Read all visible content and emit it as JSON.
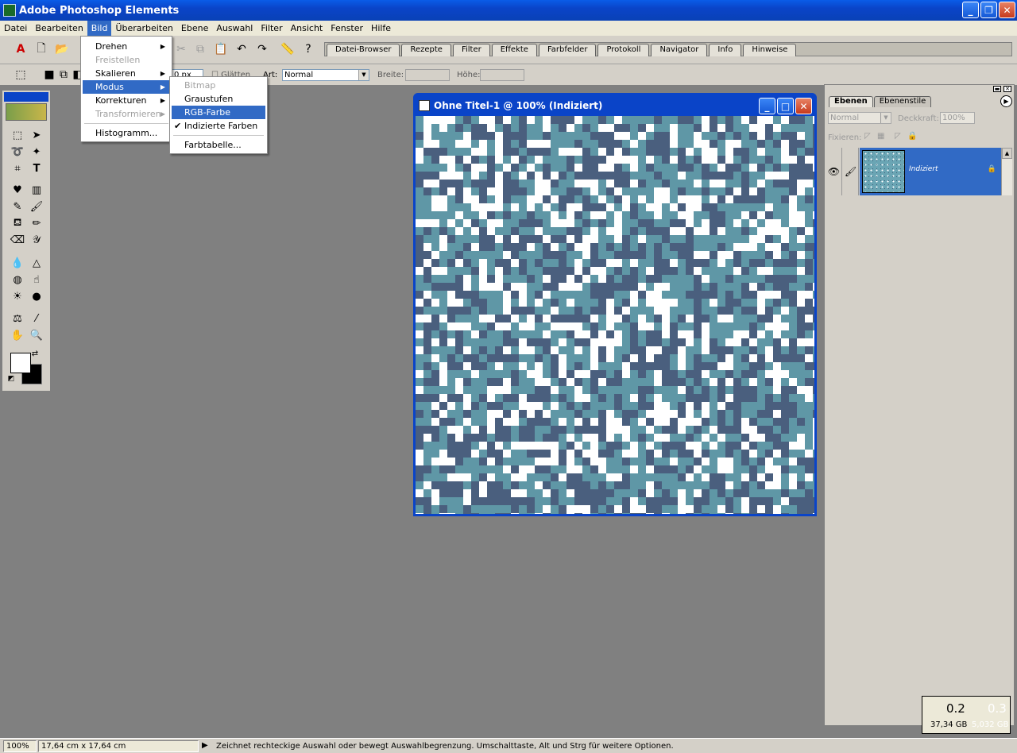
{
  "app": {
    "title": "Adobe Photoshop Elements"
  },
  "menubar": {
    "items": [
      "Datei",
      "Bearbeiten",
      "Bild",
      "Überarbeiten",
      "Ebene",
      "Auswahl",
      "Filter",
      "Ansicht",
      "Fenster",
      "Hilfe"
    ],
    "active_index": 2
  },
  "palette_well": {
    "tabs": [
      "Datei-Browser",
      "Rezepte",
      "Filter",
      "Effekte",
      "Farbfelder",
      "Protokoll",
      "Navigator",
      "Info",
      "Hinweise"
    ]
  },
  "options": {
    "feather_value": "0 px",
    "smooth_label": "Glätten",
    "style_label": "Art:",
    "style_value": "Normal",
    "width_label": "Breite:",
    "height_label": "Höhe:"
  },
  "bild_menu": {
    "items": [
      {
        "label": "Drehen",
        "submenu": true,
        "disabled": false
      },
      {
        "label": "Freistellen",
        "submenu": false,
        "disabled": true
      },
      {
        "label": "Skalieren",
        "submenu": true,
        "disabled": false
      },
      {
        "label": "Modus",
        "submenu": true,
        "disabled": false,
        "highlighted": true
      },
      {
        "label": "Korrekturen",
        "submenu": true,
        "disabled": false
      },
      {
        "label": "Transformieren",
        "submenu": true,
        "disabled": true
      },
      {
        "label": "Histogramm...",
        "submenu": false,
        "disabled": false
      }
    ]
  },
  "modus_menu": {
    "items": [
      {
        "label": "Bitmap",
        "disabled": true
      },
      {
        "label": "Graustufen",
        "disabled": false
      },
      {
        "label": "RGB-Farbe",
        "disabled": false,
        "highlighted": true
      },
      {
        "label": "Indizierte Farben",
        "disabled": false,
        "checked": true
      },
      {
        "label": "Farbtabelle...",
        "disabled": false
      }
    ]
  },
  "document": {
    "title": "Ohne Titel-1 @ 100% (Indiziert)"
  },
  "layers_palette": {
    "tabs": [
      "Ebenen",
      "Ebenenstile"
    ],
    "blend_mode": "Normal",
    "opacity_label": "Deckkraft:",
    "opacity_value": "100%",
    "lock_label": "Fixieren:",
    "layer_name": "Indiziert"
  },
  "memory": {
    "value1": "0.2",
    "value2": "0.3",
    "size1": "37,34 GB",
    "size2": "5,032 GB"
  },
  "status": {
    "zoom": "100%",
    "doc_size": "17,64 cm x 17,64 cm",
    "message": "Zeichnet rechteckige Auswahl oder bewegt Auswahlbegrenzung.  Umschalttaste, Alt und Strg für weitere Optionen."
  },
  "colors": {
    "accent": "#316ac5",
    "titlebar": "#0a44c8",
    "canvas_teal": "#5f97a6",
    "canvas_navy": "#4a5f7e",
    "canvas_white": "#ffffff"
  }
}
